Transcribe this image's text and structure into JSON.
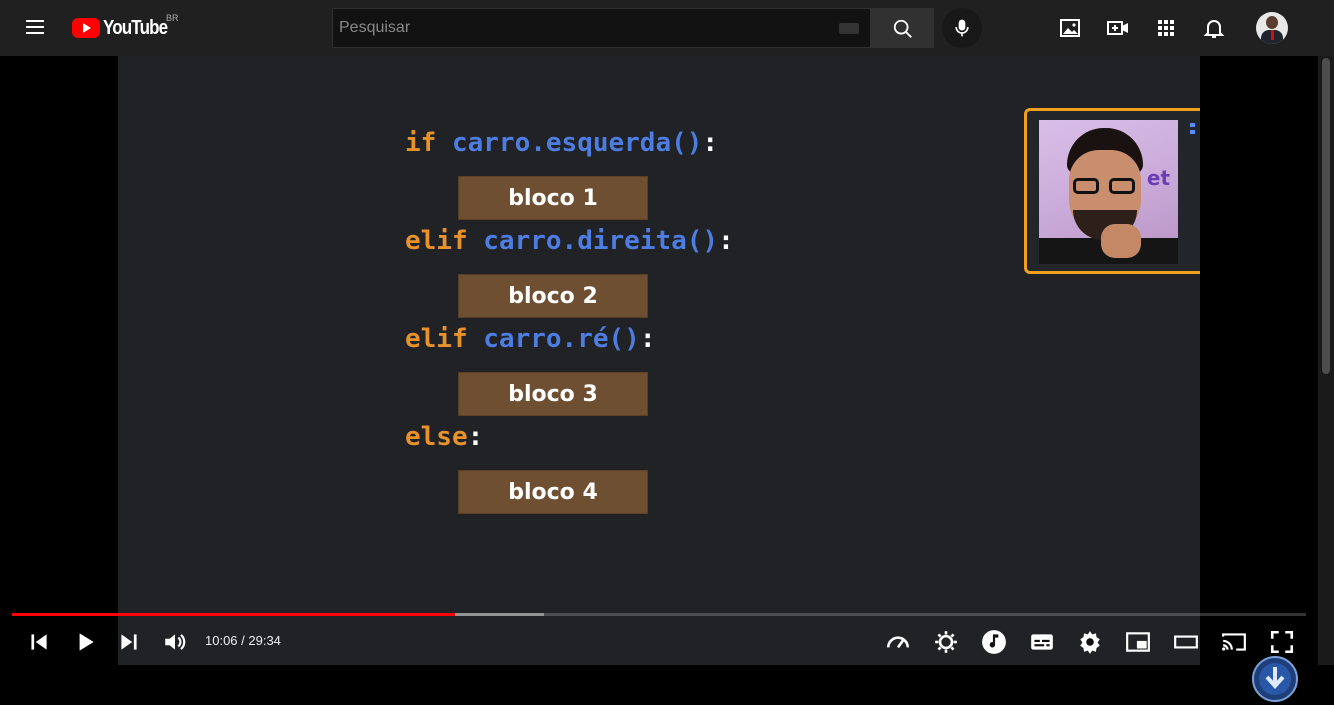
{
  "masthead": {
    "logo_text": "YouTube",
    "country_code": "BR",
    "search_placeholder": "Pesquisar",
    "icons": [
      "menu-icon",
      "search-icon",
      "mic-icon",
      "image-icon",
      "create-video-icon",
      "apps-icon",
      "notifications-icon"
    ]
  },
  "video": {
    "code_lines": [
      {
        "keyword": "if",
        "expr": "carro.esquerda()",
        "punct": ":"
      },
      {
        "keyword": "elif",
        "expr": "carro.direita()",
        "punct": ":"
      },
      {
        "keyword": "elif",
        "expr": "carro.ré()",
        "punct": ":"
      },
      {
        "keyword": "else",
        "expr": "",
        "punct": ":"
      }
    ],
    "blocks": [
      "bloco 1",
      "bloco 2",
      "bloco 3",
      "bloco 4"
    ],
    "webcam_background_text": "et"
  },
  "player": {
    "time_current": "10:06",
    "time_total": "29:34",
    "time_display": "10:06 / 29:34",
    "progress_played_fraction": 0.342,
    "progress_buffered_fraction": 0.411,
    "colors": {
      "progress": "#ff0000",
      "keyword": "#e8922a",
      "function": "#4d7de0",
      "block": "#6e4f32",
      "webcam_border": "#f2a11d"
    },
    "control_icons": [
      "previous-icon",
      "play-icon",
      "next-icon",
      "volume-icon",
      "speed-icon",
      "settings-gear-icon",
      "music-note-icon",
      "subtitles-icon",
      "settings-icon",
      "miniplayer-icon",
      "theater-mode-icon",
      "cast-icon",
      "fullscreen-icon"
    ]
  }
}
